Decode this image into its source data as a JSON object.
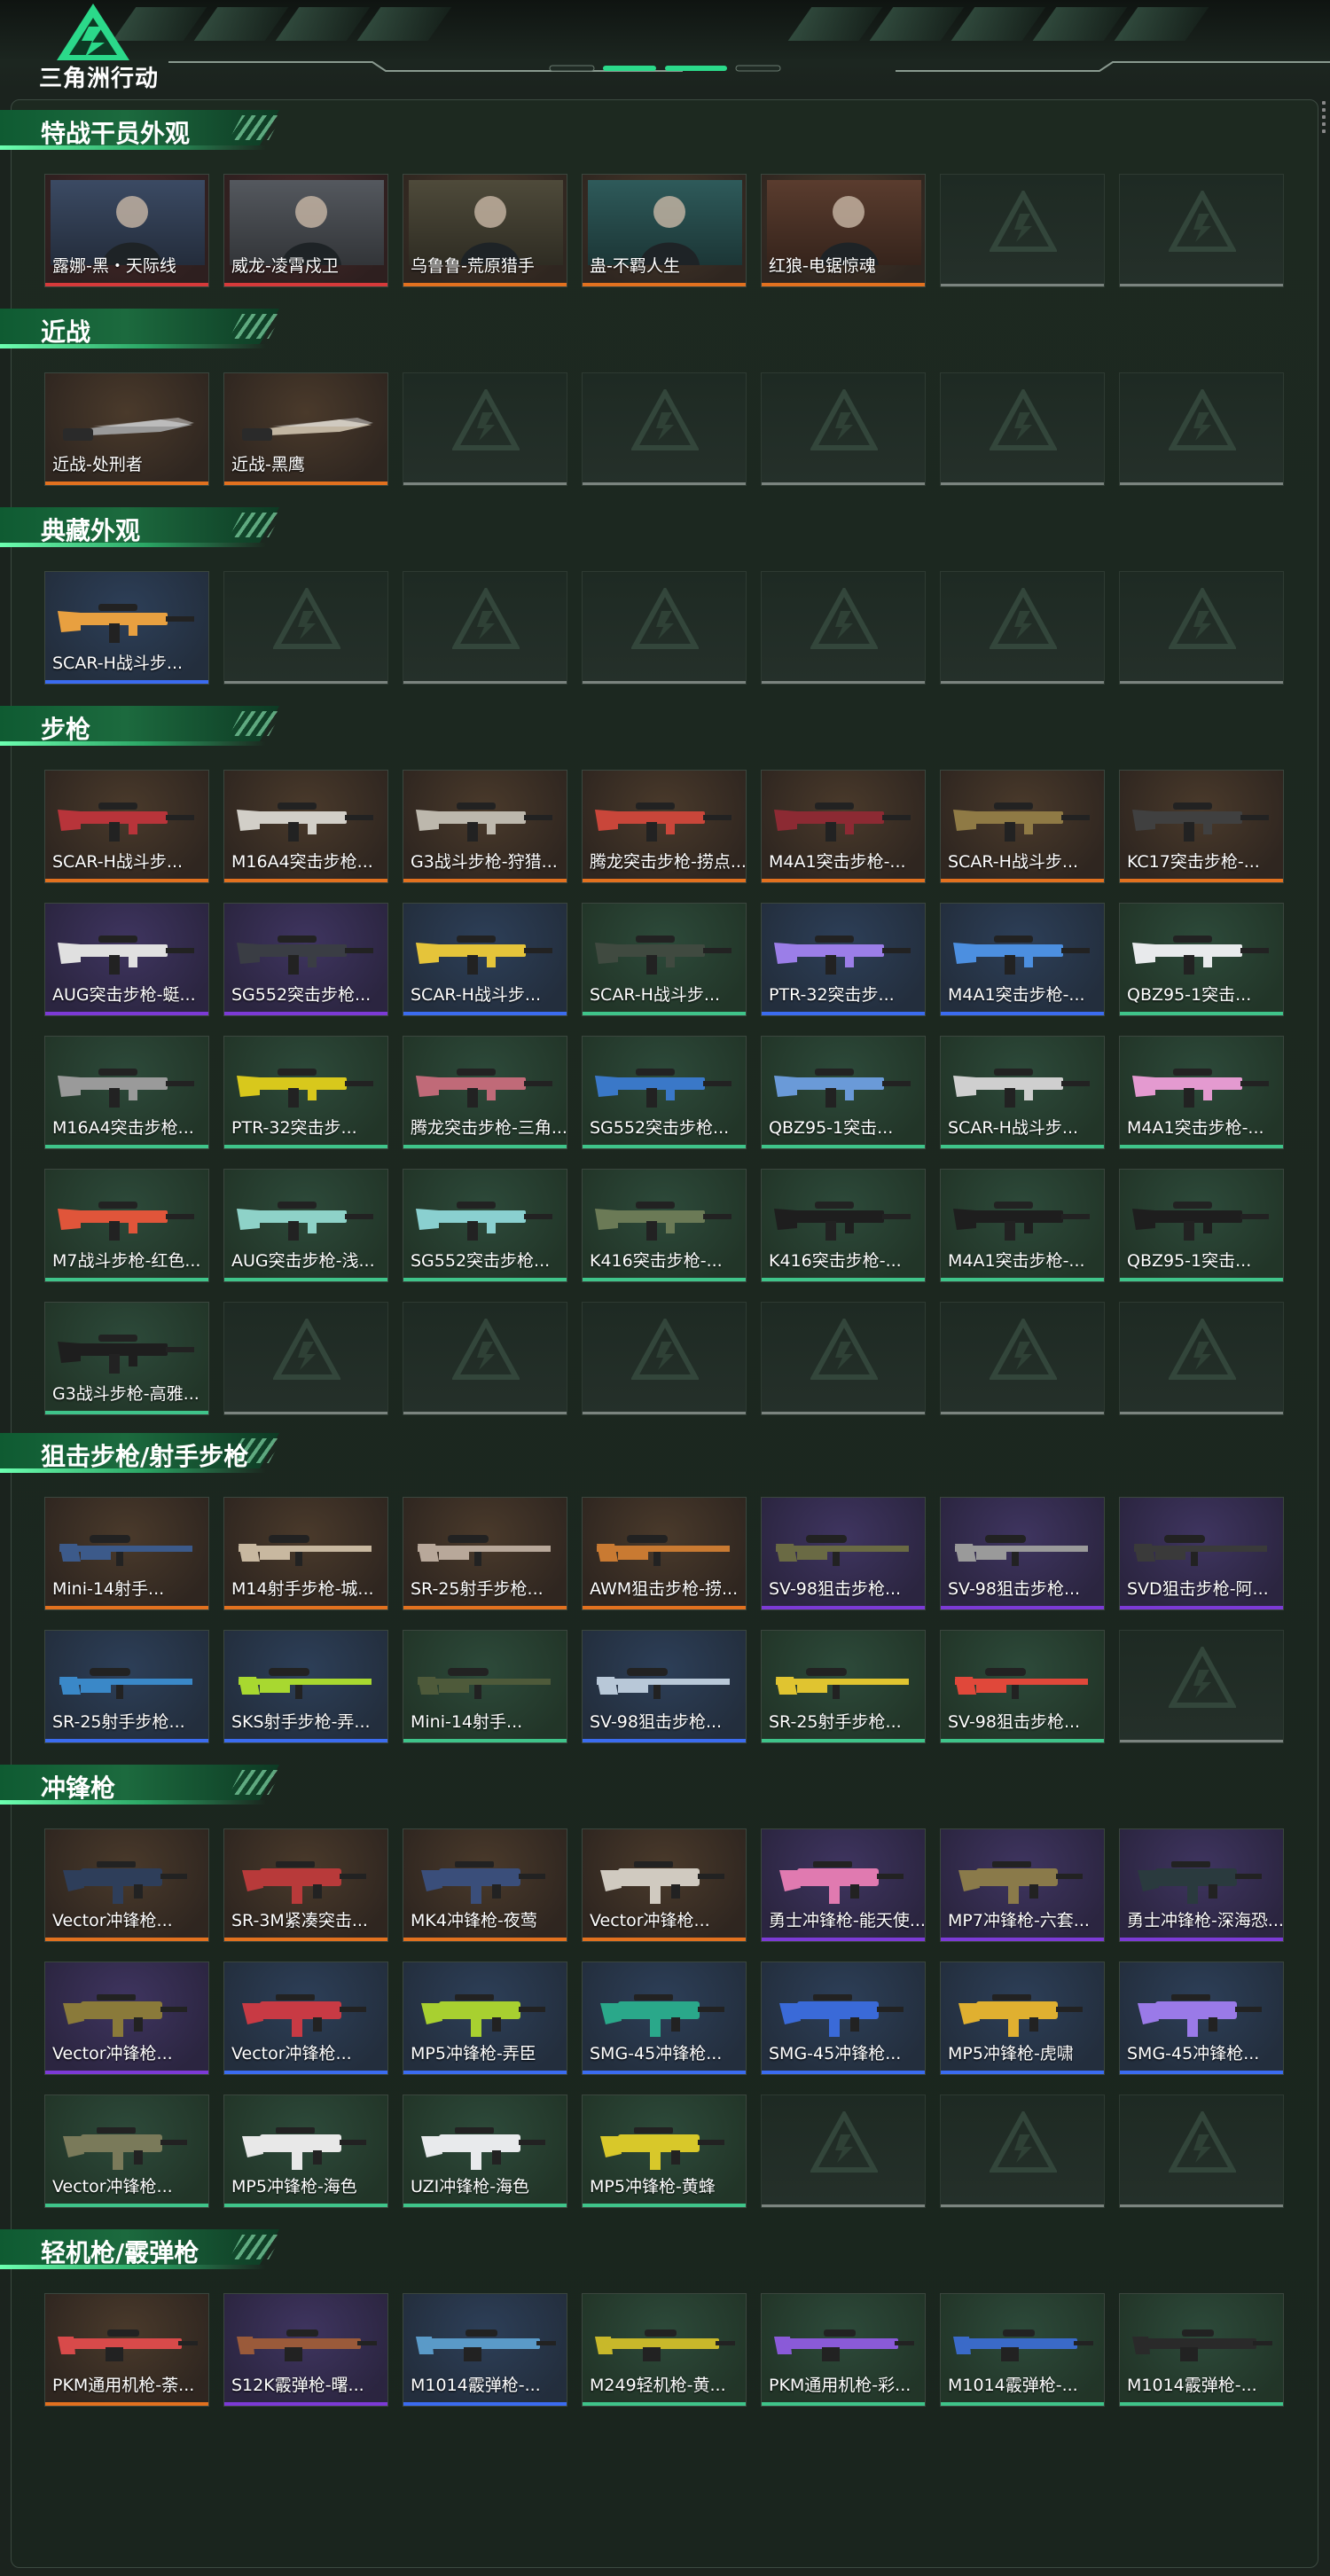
{
  "header": {
    "logo_text": "三角洲行动"
  },
  "colors": {
    "accent": "#2aa564",
    "rarity_gold": "#e2711f",
    "rarity_purple": "#7c3ad6",
    "rarity_blue": "#3b6cf0",
    "rarity_green": "#3fc48a",
    "rarity_red": "#d63a3a"
  },
  "sections": [
    {
      "title": "特战干员外观",
      "items": [
        {
          "label": "露娜-黑・天际线",
          "rarity": "red",
          "kind": "portrait",
          "tone": "#3b4a63"
        },
        {
          "label": "威龙-凌霄戍卫",
          "rarity": "red",
          "kind": "portrait",
          "tone": "#54585e"
        },
        {
          "label": "乌鲁鲁-荒原猎手",
          "rarity": "gold",
          "kind": "portrait",
          "tone": "#4e4a3a"
        },
        {
          "label": "蛊-不羁人生",
          "rarity": "gold",
          "kind": "portrait",
          "tone": "#2e5a5a"
        },
        {
          "label": "红狼-电锯惊魂",
          "rarity": "gold",
          "kind": "portrait",
          "tone": "#5a3c2e"
        },
        {
          "empty": true
        },
        {
          "empty": true
        }
      ]
    },
    {
      "title": "近战",
      "items": [
        {
          "label": "近战-处刑者",
          "rarity": "gold",
          "kind": "knife",
          "tone": "#9a9a9a"
        },
        {
          "label": "近战-黑鹰",
          "rarity": "gold",
          "kind": "knife",
          "tone": "#c2b6a2"
        },
        {
          "empty": true
        },
        {
          "empty": true
        },
        {
          "empty": true
        },
        {
          "empty": true
        },
        {
          "empty": true
        }
      ]
    },
    {
      "title": "典藏外观",
      "items": [
        {
          "label": "SCAR-H战斗步...",
          "rarity": "blue",
          "kind": "rifle",
          "tone": "#e8a040"
        },
        {
          "empty": true
        },
        {
          "empty": true
        },
        {
          "empty": true
        },
        {
          "empty": true
        },
        {
          "empty": true
        },
        {
          "empty": true
        }
      ]
    },
    {
      "title": "步枪",
      "items": [
        {
          "label": "SCAR-H战斗步...",
          "rarity": "gold",
          "kind": "rifle",
          "tone": "#b8343a"
        },
        {
          "label": "M16A4突击步枪...",
          "rarity": "gold",
          "kind": "rifle",
          "tone": "#d2cfc8"
        },
        {
          "label": "G3战斗步枪-狩猎...",
          "rarity": "gold",
          "kind": "rifle",
          "tone": "#bdb8ad"
        },
        {
          "label": "腾龙突击步枪-捞点...",
          "rarity": "gold",
          "kind": "rifle",
          "tone": "#c9463a"
        },
        {
          "label": "M4A1突击步枪-...",
          "rarity": "gold",
          "kind": "rifle",
          "tone": "#8c2a33"
        },
        {
          "label": "SCAR-H战斗步...",
          "rarity": "gold",
          "kind": "rifle",
          "tone": "#8f7a45"
        },
        {
          "label": "KC17突击步枪-...",
          "rarity": "gold",
          "kind": "rifle",
          "tone": "#404040"
        },
        {
          "label": "AUG突击步枪-蜓...",
          "rarity": "purple",
          "kind": "rifle",
          "tone": "#e0e0e0"
        },
        {
          "label": "SG552突击步枪...",
          "rarity": "purple",
          "kind": "rifle",
          "tone": "#3a3d44"
        },
        {
          "label": "SCAR-H战斗步...",
          "rarity": "blue",
          "kind": "rifle",
          "tone": "#e5c43a"
        },
        {
          "label": "SCAR-H战斗步...",
          "rarity": "green",
          "kind": "rifle",
          "tone": "#404a40"
        },
        {
          "label": "PTR-32突击步...",
          "rarity": "blue",
          "kind": "rifle",
          "tone": "#9b7ee8"
        },
        {
          "label": "M4A1突击步枪-...",
          "rarity": "blue",
          "kind": "rifle",
          "tone": "#4c8fe0"
        },
        {
          "label": "QBZ95-1突击...",
          "rarity": "green",
          "kind": "rifle",
          "tone": "#e8eaec"
        },
        {
          "label": "M16A4突击步枪...",
          "rarity": "green",
          "kind": "rifle",
          "tone": "#9a9a9a"
        },
        {
          "label": "PTR-32突击步...",
          "rarity": "green",
          "kind": "rifle",
          "tone": "#d8c81c"
        },
        {
          "label": "腾龙突击步枪-三角...",
          "rarity": "green",
          "kind": "rifle",
          "tone": "#c06a78"
        },
        {
          "label": "SG552突击步枪...",
          "rarity": "green",
          "kind": "rifle",
          "tone": "#3a78c8"
        },
        {
          "label": "QBZ95-1突击...",
          "rarity": "green",
          "kind": "rifle",
          "tone": "#6a9ad8"
        },
        {
          "label": "SCAR-H战斗步...",
          "rarity": "green",
          "kind": "rifle",
          "tone": "#cfcfcf"
        },
        {
          "label": "M4A1突击步枪-...",
          "rarity": "green",
          "kind": "rifle",
          "tone": "#e49ad0"
        },
        {
          "label": "M7战斗步枪-红色...",
          "rarity": "green",
          "kind": "rifle",
          "tone": "#e0553a"
        },
        {
          "label": "AUG突击步枪-浅...",
          "rarity": "green",
          "kind": "rifle",
          "tone": "#8ed2c8"
        },
        {
          "label": "SG552突击步枪...",
          "rarity": "green",
          "kind": "rifle",
          "tone": "#8ad0d0"
        },
        {
          "label": "K416突击步枪-...",
          "rarity": "green",
          "kind": "rifle",
          "tone": "#6b7a56"
        },
        {
          "label": "K416突击步枪-...",
          "rarity": "green",
          "kind": "rifle",
          "tone": "#1e1e1e"
        },
        {
          "label": "M4A1突击步枪-...",
          "rarity": "green",
          "kind": "rifle",
          "tone": "#1e1e1e"
        },
        {
          "label": "QBZ95-1突击...",
          "rarity": "green",
          "kind": "rifle",
          "tone": "#1e1e1e"
        },
        {
          "label": "G3战斗步枪-高雅...",
          "rarity": "green",
          "kind": "rifle",
          "tone": "#1e1e1e"
        },
        {
          "empty": true
        },
        {
          "empty": true
        },
        {
          "empty": true
        },
        {
          "empty": true
        },
        {
          "empty": true
        },
        {
          "empty": true
        }
      ]
    },
    {
      "title": "狙击步枪/射手步枪",
      "items": [
        {
          "label": "Mini-14射手...",
          "rarity": "gold",
          "kind": "sniper",
          "tone": "#3c5a8a"
        },
        {
          "label": "M14射手步枪-城...",
          "rarity": "gold",
          "kind": "sniper",
          "tone": "#c8b8a0"
        },
        {
          "label": "SR-25射手步枪...",
          "rarity": "gold",
          "kind": "sniper",
          "tone": "#b8a89a"
        },
        {
          "label": "AWM狙击步枪-捞...",
          "rarity": "gold",
          "kind": "sniper",
          "tone": "#c97a32"
        },
        {
          "label": "SV-98狙击步枪...",
          "rarity": "purple",
          "kind": "sniper",
          "tone": "#6a6a44"
        },
        {
          "label": "SV-98狙击步枪...",
          "rarity": "purple",
          "kind": "sniper",
          "tone": "#9a9a9a"
        },
        {
          "label": "SVD狙击步枪-阿...",
          "rarity": "purple",
          "kind": "sniper",
          "tone": "#3a3a3a"
        },
        {
          "label": "SR-25射手步枪...",
          "rarity": "blue",
          "kind": "sniper",
          "tone": "#3a88c8"
        },
        {
          "label": "SKS射手步枪-弄...",
          "rarity": "blue",
          "kind": "sniper",
          "tone": "#a8d830"
        },
        {
          "label": "Mini-14射手...",
          "rarity": "green",
          "kind": "sniper",
          "tone": "#4e5a3a"
        },
        {
          "label": "SV-98狙击步枪...",
          "rarity": "blue",
          "kind": "sniper",
          "tone": "#b8c8d8"
        },
        {
          "label": "SR-25射手步枪...",
          "rarity": "green",
          "kind": "sniper",
          "tone": "#e0c430"
        },
        {
          "label": "SV-98狙击步枪...",
          "rarity": "green",
          "kind": "sniper",
          "tone": "#e0483a"
        },
        {
          "empty": true
        }
      ]
    },
    {
      "title": "冲锋枪",
      "items": [
        {
          "label": "Vector冲锋枪...",
          "rarity": "gold",
          "kind": "smg",
          "tone": "#2e3e5a"
        },
        {
          "label": "SR-3M紧凑突击...",
          "rarity": "gold",
          "kind": "smg",
          "tone": "#b83a3a"
        },
        {
          "label": "MK4冲锋枪-夜莺",
          "rarity": "gold",
          "kind": "smg",
          "tone": "#3a4e7a"
        },
        {
          "label": "Vector冲锋枪...",
          "rarity": "gold",
          "kind": "smg",
          "tone": "#d0cac0"
        },
        {
          "label": "勇士冲锋枪-能天使...",
          "rarity": "purple",
          "kind": "smg",
          "tone": "#e07ab0"
        },
        {
          "label": "MP7冲锋枪-六套...",
          "rarity": "purple",
          "kind": "smg",
          "tone": "#8a7a4a"
        },
        {
          "label": "勇士冲锋枪-深海恐...",
          "rarity": "purple",
          "kind": "smg",
          "tone": "#2a3a3e"
        },
        {
          "label": "Vector冲锋枪...",
          "rarity": "purple",
          "kind": "smg",
          "tone": "#8a7a3a"
        },
        {
          "label": "Vector冲锋枪...",
          "rarity": "blue",
          "kind": "smg",
          "tone": "#c83a44"
        },
        {
          "label": "MP5冲锋枪-弄臣",
          "rarity": "blue",
          "kind": "smg",
          "tone": "#a8d030"
        },
        {
          "label": "SMG-45冲锋枪...",
          "rarity": "blue",
          "kind": "smg",
          "tone": "#2aa88a"
        },
        {
          "label": "SMG-45冲锋枪...",
          "rarity": "blue",
          "kind": "smg",
          "tone": "#3a6ad8"
        },
        {
          "label": "MP5冲锋枪-虎啸",
          "rarity": "blue",
          "kind": "smg",
          "tone": "#e0b030"
        },
        {
          "label": "SMG-45冲锋枪...",
          "rarity": "blue",
          "kind": "smg",
          "tone": "#9a7ae8"
        },
        {
          "label": "Vector冲锋枪...",
          "rarity": "green",
          "kind": "smg",
          "tone": "#7a7a5a"
        },
        {
          "label": "MP5冲锋枪-海色",
          "rarity": "green",
          "kind": "smg",
          "tone": "#e8e8e8"
        },
        {
          "label": "UZI冲锋枪-海色",
          "rarity": "green",
          "kind": "smg",
          "tone": "#e8eaec"
        },
        {
          "label": "MP5冲锋枪-黄蜂",
          "rarity": "green",
          "kind": "smg",
          "tone": "#d8c82a"
        },
        {
          "empty": true
        },
        {
          "empty": true
        },
        {
          "empty": true
        }
      ]
    },
    {
      "title": "轻机枪/霰弹枪",
      "items": [
        {
          "label": "PKM通用机枪-荼...",
          "rarity": "gold",
          "kind": "lmg",
          "tone": "#d84a4a"
        },
        {
          "label": "S12K霰弹枪-曙...",
          "rarity": "purple",
          "kind": "lmg",
          "tone": "#9a5a3a"
        },
        {
          "label": "M1014霰弹枪-...",
          "rarity": "blue",
          "kind": "lmg",
          "tone": "#5a9ac8"
        },
        {
          "label": "M249轻机枪-黄...",
          "rarity": "green",
          "kind": "lmg",
          "tone": "#c8b82a"
        },
        {
          "label": "PKM通用机枪-彩...",
          "rarity": "green",
          "kind": "lmg",
          "tone": "#8a5ad8"
        },
        {
          "label": "M1014霰弹枪-...",
          "rarity": "green",
          "kind": "lmg",
          "tone": "#3a6ac8"
        },
        {
          "label": "M1014霰弹枪-...",
          "rarity": "green",
          "kind": "lmg",
          "tone": "#2a2a2a"
        }
      ]
    }
  ]
}
